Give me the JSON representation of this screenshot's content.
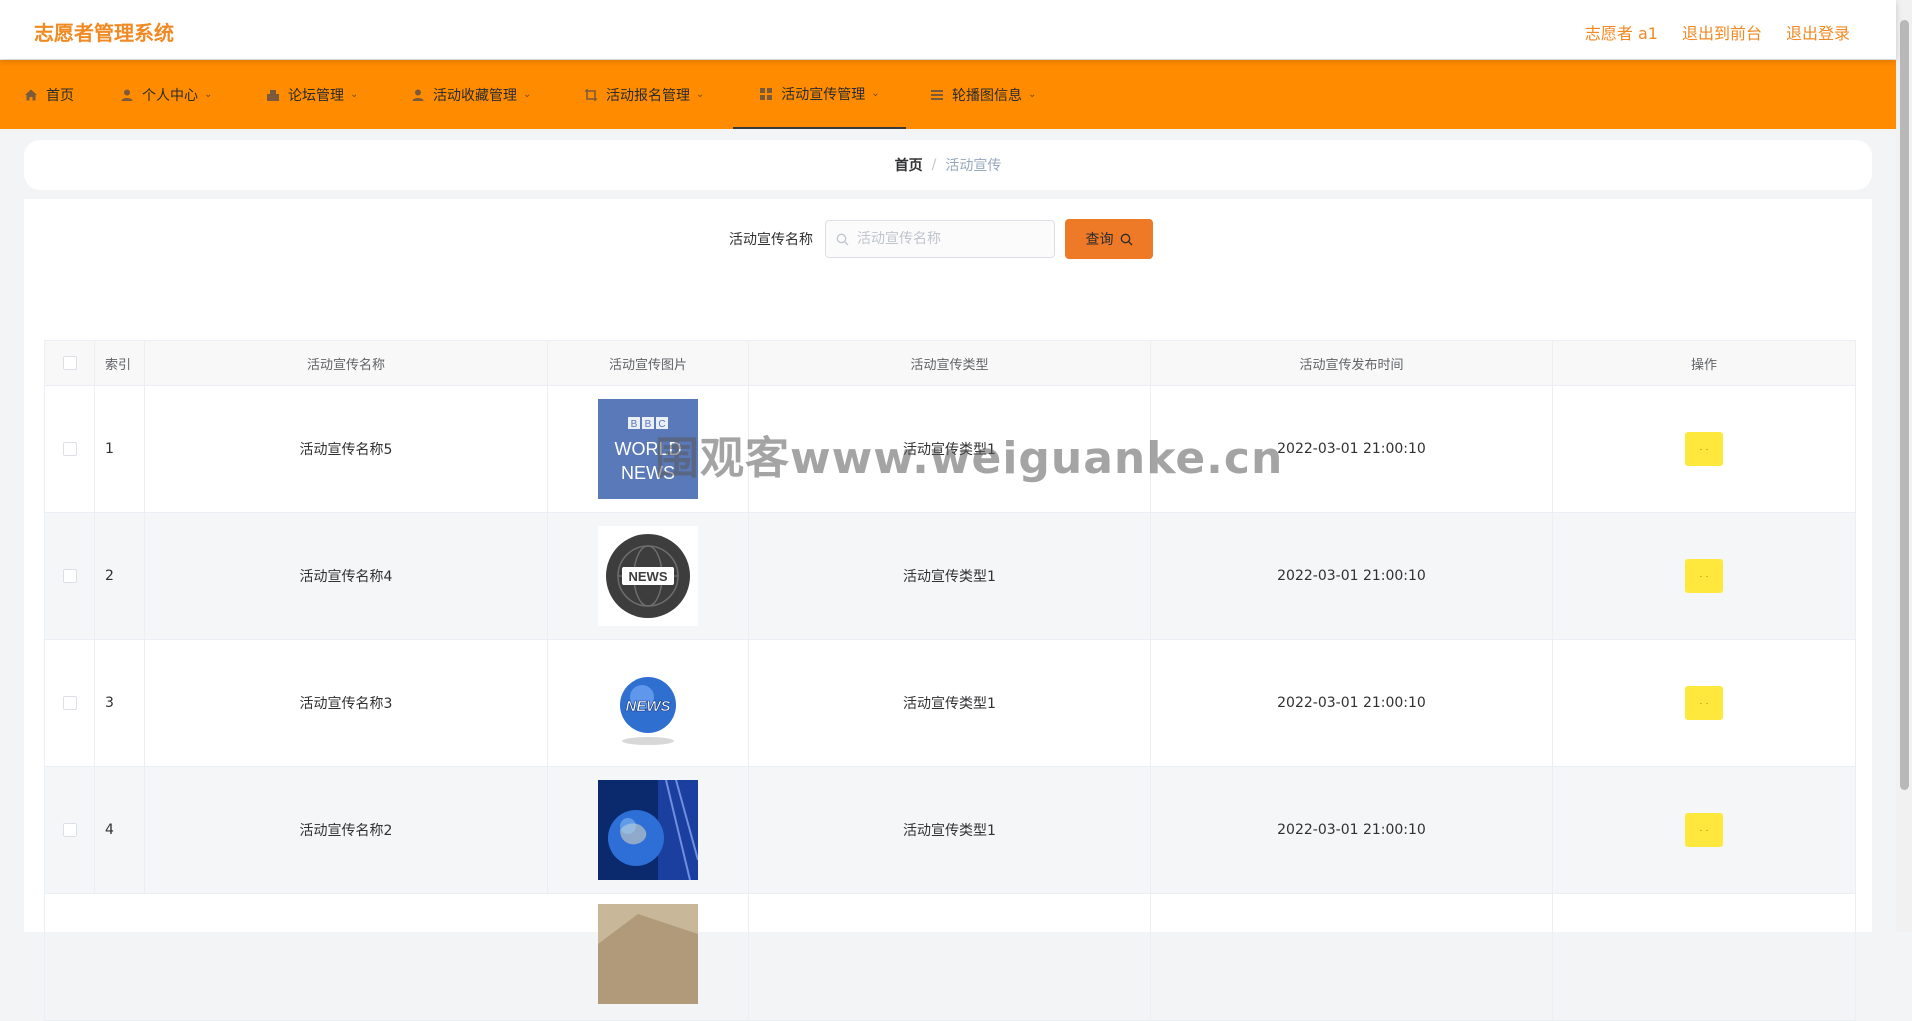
{
  "header": {
    "title": "志愿者管理系统",
    "user": "志愿者 a1",
    "to_front": "退出到前台",
    "logout": "退出登录"
  },
  "nav": {
    "items": [
      {
        "label": "首页",
        "icon": "home-icon"
      },
      {
        "label": "个人中心",
        "icon": "user-icon"
      },
      {
        "label": "论坛管理",
        "icon": "forum-icon"
      },
      {
        "label": "活动收藏管理",
        "icon": "user-icon"
      },
      {
        "label": "活动报名管理",
        "icon": "crop-icon"
      },
      {
        "label": "活动宣传管理",
        "icon": "grid-icon",
        "active": true
      },
      {
        "label": "轮播图信息",
        "icon": "list-icon"
      }
    ]
  },
  "breadcrumb": {
    "home": "首页",
    "separator": "/",
    "current": "活动宣传"
  },
  "search": {
    "label": "活动宣传名称",
    "placeholder": "活动宣传名称",
    "button": "查询"
  },
  "table": {
    "headers": [
      "索引",
      "活动宣传名称",
      "活动宣传图片",
      "活动宣传类型",
      "活动宣传发布时间",
      "操作"
    ],
    "rows": [
      {
        "index": "1",
        "name": "活动宣传名称5",
        "image": "bbc-world-news-logo",
        "type": "活动宣传类型1",
        "time": "2022-03-01 21:00:10"
      },
      {
        "index": "2",
        "name": "活动宣传名称4",
        "image": "news-globe-badge",
        "type": "活动宣传类型1",
        "time": "2022-03-01 21:00:10"
      },
      {
        "index": "3",
        "name": "活动宣传名称3",
        "image": "news-blue-globe",
        "type": "活动宣传类型1",
        "time": "2022-03-01 21:00:10"
      },
      {
        "index": "4",
        "name": "活动宣传名称2",
        "image": "earth-studio",
        "type": "活动宣传类型1",
        "time": "2022-03-01 21:00:10"
      },
      {
        "index": "",
        "name": "",
        "image": "partial-photo",
        "type": "",
        "time": ""
      }
    ],
    "op_label": "· ·"
  },
  "watermark": "围观客www.weiguanke.cn",
  "colors": {
    "brand": "#f08a24",
    "nav_bg": "#ff8c00",
    "query_btn": "#ee7a28",
    "op_btn": "#ffe83d"
  }
}
